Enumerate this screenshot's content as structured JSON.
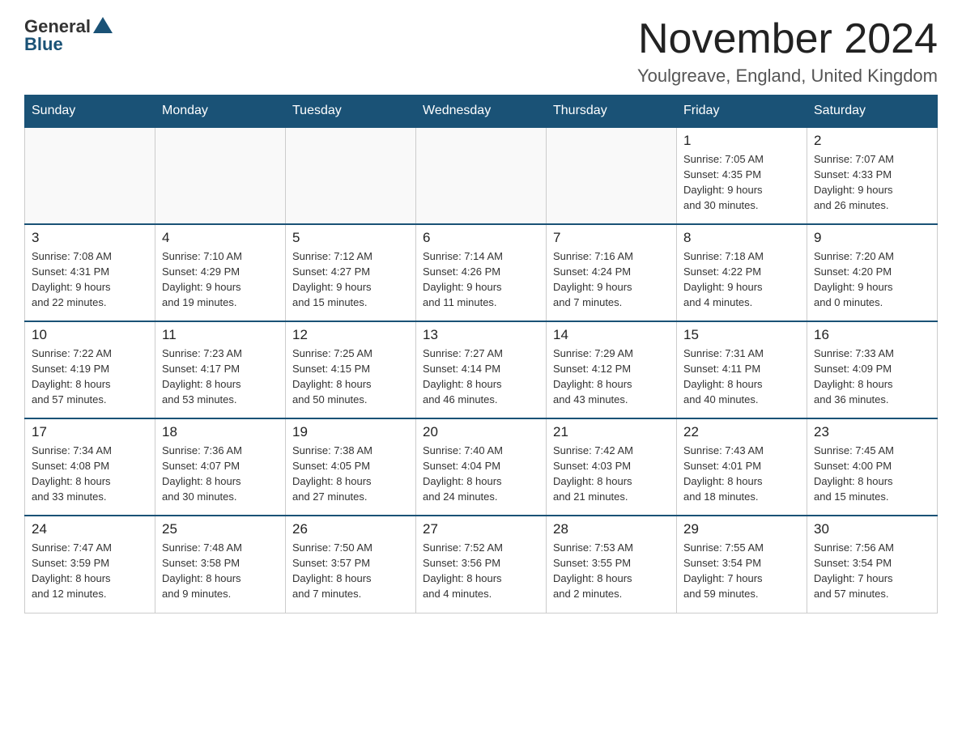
{
  "logo": {
    "general": "General",
    "blue": "Blue"
  },
  "header": {
    "month": "November 2024",
    "location": "Youlgreave, England, United Kingdom"
  },
  "weekdays": [
    "Sunday",
    "Monday",
    "Tuesday",
    "Wednesday",
    "Thursday",
    "Friday",
    "Saturday"
  ],
  "weeks": [
    [
      {
        "day": "",
        "info": ""
      },
      {
        "day": "",
        "info": ""
      },
      {
        "day": "",
        "info": ""
      },
      {
        "day": "",
        "info": ""
      },
      {
        "day": "",
        "info": ""
      },
      {
        "day": "1",
        "info": "Sunrise: 7:05 AM\nSunset: 4:35 PM\nDaylight: 9 hours\nand 30 minutes."
      },
      {
        "day": "2",
        "info": "Sunrise: 7:07 AM\nSunset: 4:33 PM\nDaylight: 9 hours\nand 26 minutes."
      }
    ],
    [
      {
        "day": "3",
        "info": "Sunrise: 7:08 AM\nSunset: 4:31 PM\nDaylight: 9 hours\nand 22 minutes."
      },
      {
        "day": "4",
        "info": "Sunrise: 7:10 AM\nSunset: 4:29 PM\nDaylight: 9 hours\nand 19 minutes."
      },
      {
        "day": "5",
        "info": "Sunrise: 7:12 AM\nSunset: 4:27 PM\nDaylight: 9 hours\nand 15 minutes."
      },
      {
        "day": "6",
        "info": "Sunrise: 7:14 AM\nSunset: 4:26 PM\nDaylight: 9 hours\nand 11 minutes."
      },
      {
        "day": "7",
        "info": "Sunrise: 7:16 AM\nSunset: 4:24 PM\nDaylight: 9 hours\nand 7 minutes."
      },
      {
        "day": "8",
        "info": "Sunrise: 7:18 AM\nSunset: 4:22 PM\nDaylight: 9 hours\nand 4 minutes."
      },
      {
        "day": "9",
        "info": "Sunrise: 7:20 AM\nSunset: 4:20 PM\nDaylight: 9 hours\nand 0 minutes."
      }
    ],
    [
      {
        "day": "10",
        "info": "Sunrise: 7:22 AM\nSunset: 4:19 PM\nDaylight: 8 hours\nand 57 minutes."
      },
      {
        "day": "11",
        "info": "Sunrise: 7:23 AM\nSunset: 4:17 PM\nDaylight: 8 hours\nand 53 minutes."
      },
      {
        "day": "12",
        "info": "Sunrise: 7:25 AM\nSunset: 4:15 PM\nDaylight: 8 hours\nand 50 minutes."
      },
      {
        "day": "13",
        "info": "Sunrise: 7:27 AM\nSunset: 4:14 PM\nDaylight: 8 hours\nand 46 minutes."
      },
      {
        "day": "14",
        "info": "Sunrise: 7:29 AM\nSunset: 4:12 PM\nDaylight: 8 hours\nand 43 minutes."
      },
      {
        "day": "15",
        "info": "Sunrise: 7:31 AM\nSunset: 4:11 PM\nDaylight: 8 hours\nand 40 minutes."
      },
      {
        "day": "16",
        "info": "Sunrise: 7:33 AM\nSunset: 4:09 PM\nDaylight: 8 hours\nand 36 minutes."
      }
    ],
    [
      {
        "day": "17",
        "info": "Sunrise: 7:34 AM\nSunset: 4:08 PM\nDaylight: 8 hours\nand 33 minutes."
      },
      {
        "day": "18",
        "info": "Sunrise: 7:36 AM\nSunset: 4:07 PM\nDaylight: 8 hours\nand 30 minutes."
      },
      {
        "day": "19",
        "info": "Sunrise: 7:38 AM\nSunset: 4:05 PM\nDaylight: 8 hours\nand 27 minutes."
      },
      {
        "day": "20",
        "info": "Sunrise: 7:40 AM\nSunset: 4:04 PM\nDaylight: 8 hours\nand 24 minutes."
      },
      {
        "day": "21",
        "info": "Sunrise: 7:42 AM\nSunset: 4:03 PM\nDaylight: 8 hours\nand 21 minutes."
      },
      {
        "day": "22",
        "info": "Sunrise: 7:43 AM\nSunset: 4:01 PM\nDaylight: 8 hours\nand 18 minutes."
      },
      {
        "day": "23",
        "info": "Sunrise: 7:45 AM\nSunset: 4:00 PM\nDaylight: 8 hours\nand 15 minutes."
      }
    ],
    [
      {
        "day": "24",
        "info": "Sunrise: 7:47 AM\nSunset: 3:59 PM\nDaylight: 8 hours\nand 12 minutes."
      },
      {
        "day": "25",
        "info": "Sunrise: 7:48 AM\nSunset: 3:58 PM\nDaylight: 8 hours\nand 9 minutes."
      },
      {
        "day": "26",
        "info": "Sunrise: 7:50 AM\nSunset: 3:57 PM\nDaylight: 8 hours\nand 7 minutes."
      },
      {
        "day": "27",
        "info": "Sunrise: 7:52 AM\nSunset: 3:56 PM\nDaylight: 8 hours\nand 4 minutes."
      },
      {
        "day": "28",
        "info": "Sunrise: 7:53 AM\nSunset: 3:55 PM\nDaylight: 8 hours\nand 2 minutes."
      },
      {
        "day": "29",
        "info": "Sunrise: 7:55 AM\nSunset: 3:54 PM\nDaylight: 7 hours\nand 59 minutes."
      },
      {
        "day": "30",
        "info": "Sunrise: 7:56 AM\nSunset: 3:54 PM\nDaylight: 7 hours\nand 57 minutes."
      }
    ]
  ]
}
